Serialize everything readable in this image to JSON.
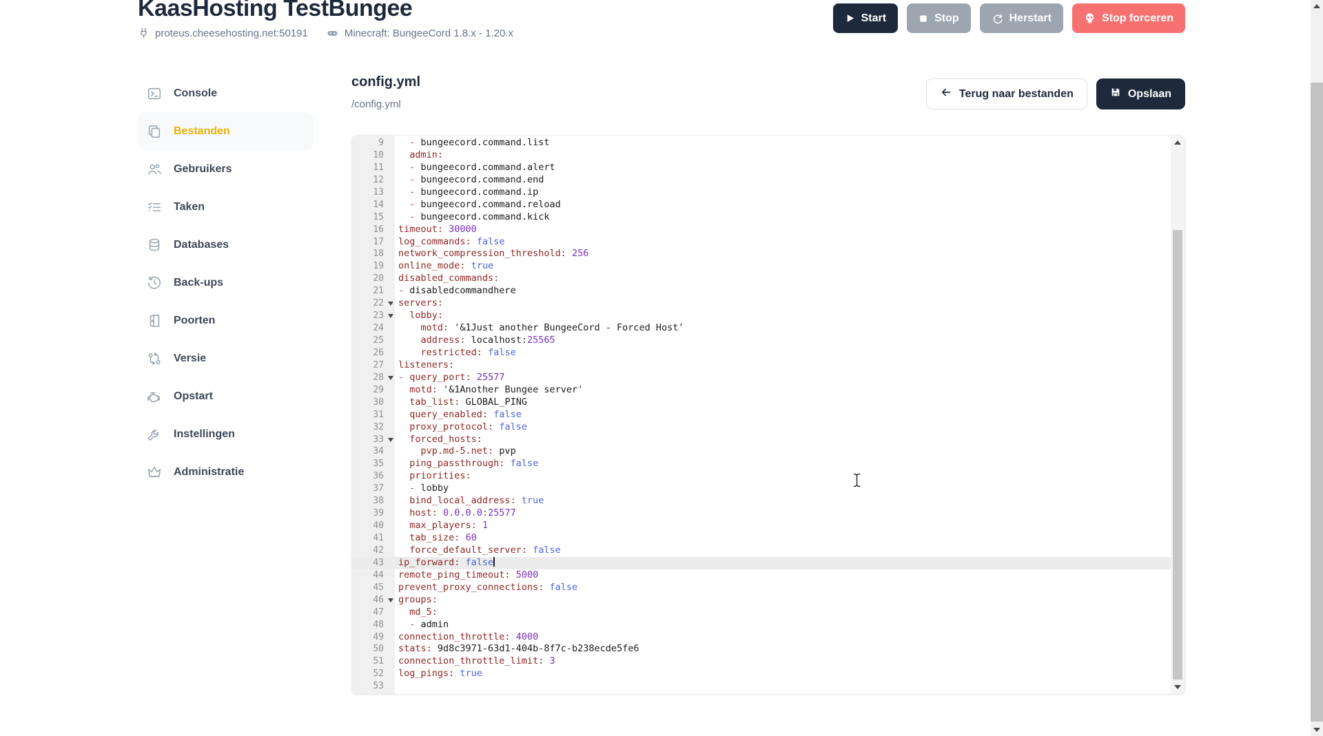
{
  "header": {
    "title": "KaasHosting TestBungee",
    "address": "proteus.cheesehosting.net:50191",
    "platform": "Minecraft: BungeeCord 1.8.x - 1.20.x",
    "buttons": [
      {
        "name": "start-button",
        "label": "Start",
        "icon": "play-icon",
        "variant": "dark"
      },
      {
        "name": "stop-button",
        "label": "Stop",
        "icon": "stop-square-icon",
        "variant": "muted"
      },
      {
        "name": "restart-button",
        "label": "Herstart",
        "icon": "restart-icon",
        "variant": "muted"
      },
      {
        "name": "force-stop-button",
        "label": "Stop forceren",
        "icon": "skull-icon",
        "variant": "danger"
      }
    ]
  },
  "sidebar": {
    "items": [
      {
        "label": "Console",
        "icon": "console-icon",
        "active": false
      },
      {
        "label": "Bestanden",
        "icon": "files-icon",
        "active": true
      },
      {
        "label": "Gebruikers",
        "icon": "users-icon",
        "active": false
      },
      {
        "label": "Taken",
        "icon": "tasks-icon",
        "active": false
      },
      {
        "label": "Databases",
        "icon": "database-icon",
        "active": false
      },
      {
        "label": "Back-ups",
        "icon": "history-icon",
        "active": false
      },
      {
        "label": "Poorten",
        "icon": "door-icon",
        "active": false
      },
      {
        "label": "Versie",
        "icon": "version-icon",
        "active": false
      },
      {
        "label": "Opstart",
        "icon": "engine-icon",
        "active": false
      },
      {
        "label": "Instellingen",
        "icon": "wrench-icon",
        "active": false
      },
      {
        "label": "Administratie",
        "icon": "crown-icon",
        "active": false
      }
    ]
  },
  "main": {
    "title": "config.yml",
    "path": "/config.yml",
    "back_label": "Terug naar bestanden",
    "save_label": "Opslaan"
  },
  "colors": {
    "accent_active": "#eab308",
    "button_dark": "#1e293b",
    "button_muted": "#9da5b1",
    "button_danger": "#f87171",
    "syntax_key": "#8f2727",
    "syntax_dash": "#d0397f",
    "syntax_number": "#7b2fbf",
    "syntax_boolean": "#4f63d8"
  },
  "editor": {
    "lines": [
      {
        "n": 9,
        "tokens": [
          [
            "p",
            "  "
          ],
          [
            "d",
            "- "
          ],
          [
            "p",
            "bungeecord.command.list"
          ]
        ]
      },
      {
        "n": 10,
        "tokens": [
          [
            "p",
            "  "
          ],
          [
            "k",
            "admin:"
          ]
        ]
      },
      {
        "n": 11,
        "tokens": [
          [
            "p",
            "  "
          ],
          [
            "d",
            "- "
          ],
          [
            "p",
            "bungeecord.command.alert"
          ]
        ]
      },
      {
        "n": 12,
        "tokens": [
          [
            "p",
            "  "
          ],
          [
            "d",
            "- "
          ],
          [
            "p",
            "bungeecord.command.end"
          ]
        ]
      },
      {
        "n": 13,
        "tokens": [
          [
            "p",
            "  "
          ],
          [
            "d",
            "- "
          ],
          [
            "p",
            "bungeecord.command.ip"
          ]
        ]
      },
      {
        "n": 14,
        "tokens": [
          [
            "p",
            "  "
          ],
          [
            "d",
            "- "
          ],
          [
            "p",
            "bungeecord.command.reload"
          ]
        ]
      },
      {
        "n": 15,
        "tokens": [
          [
            "p",
            "  "
          ],
          [
            "d",
            "- "
          ],
          [
            "p",
            "bungeecord.command.kick"
          ]
        ]
      },
      {
        "n": 16,
        "tokens": [
          [
            "k",
            "timeout:"
          ],
          [
            "p",
            " "
          ],
          [
            "n",
            "30000"
          ]
        ]
      },
      {
        "n": 17,
        "tokens": [
          [
            "k",
            "log_commands:"
          ],
          [
            "p",
            " "
          ],
          [
            "b",
            "false"
          ]
        ]
      },
      {
        "n": 18,
        "tokens": [
          [
            "k",
            "network_compression_threshold:"
          ],
          [
            "p",
            " "
          ],
          [
            "n",
            "256"
          ]
        ]
      },
      {
        "n": 19,
        "tokens": [
          [
            "k",
            "online_mode:"
          ],
          [
            "p",
            " "
          ],
          [
            "b",
            "true"
          ]
        ]
      },
      {
        "n": 20,
        "tokens": [
          [
            "k",
            "disabled_commands:"
          ]
        ]
      },
      {
        "n": 21,
        "tokens": [
          [
            "d",
            "- "
          ],
          [
            "p",
            "disabledcommandhere"
          ]
        ]
      },
      {
        "n": 22,
        "fold": true,
        "tokens": [
          [
            "k",
            "servers:"
          ]
        ]
      },
      {
        "n": 23,
        "fold": true,
        "tokens": [
          [
            "p",
            "  "
          ],
          [
            "k",
            "lobby:"
          ]
        ]
      },
      {
        "n": 24,
        "tokens": [
          [
            "p",
            "    "
          ],
          [
            "k",
            "motd:"
          ],
          [
            "p",
            " '&1Just another BungeeCord - Forced Host'"
          ]
        ]
      },
      {
        "n": 25,
        "tokens": [
          [
            "p",
            "    "
          ],
          [
            "k",
            "address:"
          ],
          [
            "p",
            " localhost:"
          ],
          [
            "n",
            "25565"
          ]
        ]
      },
      {
        "n": 26,
        "tokens": [
          [
            "p",
            "    "
          ],
          [
            "k",
            "restricted:"
          ],
          [
            "p",
            " "
          ],
          [
            "b",
            "false"
          ]
        ]
      },
      {
        "n": 27,
        "tokens": [
          [
            "k",
            "listeners:"
          ]
        ]
      },
      {
        "n": 28,
        "fold": true,
        "tokens": [
          [
            "d",
            "- "
          ],
          [
            "k",
            "query_port:"
          ],
          [
            "p",
            " "
          ],
          [
            "n",
            "25577"
          ]
        ]
      },
      {
        "n": 29,
        "tokens": [
          [
            "p",
            "  "
          ],
          [
            "k",
            "motd:"
          ],
          [
            "p",
            " '&1Another Bungee server'"
          ]
        ]
      },
      {
        "n": 30,
        "tokens": [
          [
            "p",
            "  "
          ],
          [
            "k",
            "tab_list:"
          ],
          [
            "p",
            " GLOBAL_PING"
          ]
        ]
      },
      {
        "n": 31,
        "tokens": [
          [
            "p",
            "  "
          ],
          [
            "k",
            "query_enabled:"
          ],
          [
            "p",
            " "
          ],
          [
            "b",
            "false"
          ]
        ]
      },
      {
        "n": 32,
        "tokens": [
          [
            "p",
            "  "
          ],
          [
            "k",
            "proxy_protocol:"
          ],
          [
            "p",
            " "
          ],
          [
            "b",
            "false"
          ]
        ]
      },
      {
        "n": 33,
        "fold": true,
        "tokens": [
          [
            "p",
            "  "
          ],
          [
            "k",
            "forced_hosts:"
          ]
        ]
      },
      {
        "n": 34,
        "tokens": [
          [
            "p",
            "    "
          ],
          [
            "k",
            "pvp.md-5.net:"
          ],
          [
            "p",
            " pvp"
          ]
        ]
      },
      {
        "n": 35,
        "tokens": [
          [
            "p",
            "  "
          ],
          [
            "k",
            "ping_passthrough:"
          ],
          [
            "p",
            " "
          ],
          [
            "b",
            "false"
          ]
        ]
      },
      {
        "n": 36,
        "tokens": [
          [
            "p",
            "  "
          ],
          [
            "k",
            "priorities:"
          ]
        ]
      },
      {
        "n": 37,
        "tokens": [
          [
            "p",
            "  "
          ],
          [
            "d",
            "- "
          ],
          [
            "p",
            "lobby"
          ]
        ]
      },
      {
        "n": 38,
        "tokens": [
          [
            "p",
            "  "
          ],
          [
            "k",
            "bind_local_address:"
          ],
          [
            "p",
            " "
          ],
          [
            "b",
            "true"
          ]
        ]
      },
      {
        "n": 39,
        "tokens": [
          [
            "p",
            "  "
          ],
          [
            "k",
            "host:"
          ],
          [
            "p",
            " "
          ],
          [
            "n",
            "0.0.0.0:25577"
          ]
        ]
      },
      {
        "n": 40,
        "tokens": [
          [
            "p",
            "  "
          ],
          [
            "k",
            "max_players:"
          ],
          [
            "p",
            " "
          ],
          [
            "n",
            "1"
          ]
        ]
      },
      {
        "n": 41,
        "tokens": [
          [
            "p",
            "  "
          ],
          [
            "k",
            "tab_size:"
          ],
          [
            "p",
            " "
          ],
          [
            "n",
            "60"
          ]
        ]
      },
      {
        "n": 42,
        "tokens": [
          [
            "p",
            "  "
          ],
          [
            "k",
            "force_default_server:"
          ],
          [
            "p",
            " "
          ],
          [
            "b",
            "false"
          ]
        ]
      },
      {
        "n": 43,
        "active": true,
        "caret": true,
        "tokens": [
          [
            "k",
            "ip_forward:"
          ],
          [
            "p",
            " "
          ],
          [
            "b",
            "false"
          ]
        ]
      },
      {
        "n": 44,
        "tokens": [
          [
            "k",
            "remote_ping_timeout:"
          ],
          [
            "p",
            " "
          ],
          [
            "n",
            "5000"
          ]
        ]
      },
      {
        "n": 45,
        "tokens": [
          [
            "k",
            "prevent_proxy_connections:"
          ],
          [
            "p",
            " "
          ],
          [
            "b",
            "false"
          ]
        ]
      },
      {
        "n": 46,
        "fold": true,
        "tokens": [
          [
            "k",
            "groups:"
          ]
        ]
      },
      {
        "n": 47,
        "tokens": [
          [
            "p",
            "  "
          ],
          [
            "k",
            "md_5:"
          ]
        ]
      },
      {
        "n": 48,
        "tokens": [
          [
            "p",
            "  "
          ],
          [
            "d",
            "- "
          ],
          [
            "p",
            "admin"
          ]
        ]
      },
      {
        "n": 49,
        "tokens": [
          [
            "k",
            "connection_throttle:"
          ],
          [
            "p",
            " "
          ],
          [
            "n",
            "4000"
          ]
        ]
      },
      {
        "n": 50,
        "tokens": [
          [
            "k",
            "stats:"
          ],
          [
            "p",
            " 9d8c3971-63d1-404b-8f7c-b238ecde5fe6"
          ]
        ]
      },
      {
        "n": 51,
        "tokens": [
          [
            "k",
            "connection_throttle_limit:"
          ],
          [
            "p",
            " "
          ],
          [
            "n",
            "3"
          ]
        ]
      },
      {
        "n": 52,
        "tokens": [
          [
            "k",
            "log_pings:"
          ],
          [
            "p",
            " "
          ],
          [
            "b",
            "true"
          ]
        ]
      },
      {
        "n": 53,
        "tokens": []
      }
    ]
  }
}
